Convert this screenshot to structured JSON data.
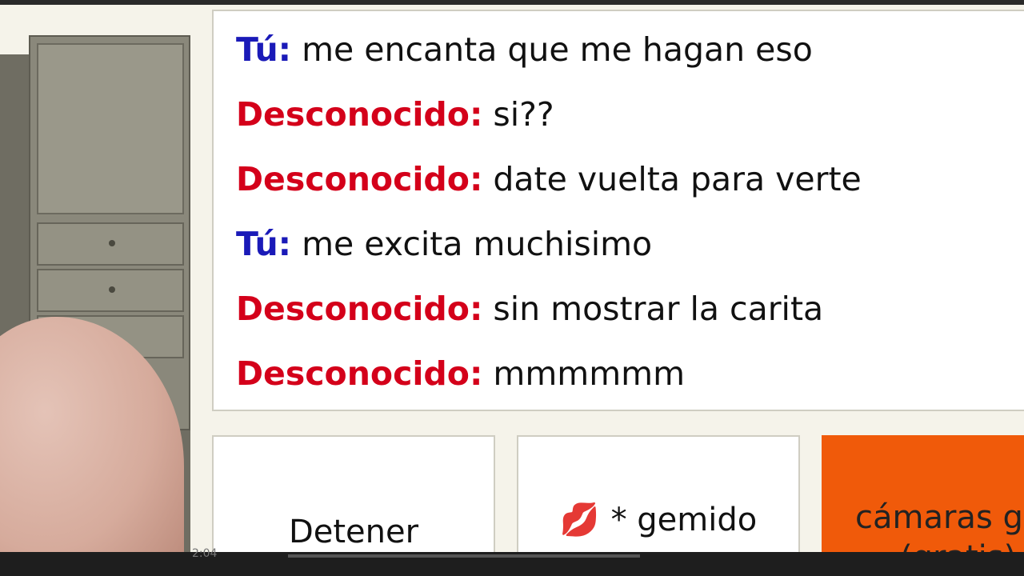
{
  "chat": {
    "messages": [
      {
        "speaker": "Tú:",
        "role": "you",
        "text": "me encanta que me hagan eso"
      },
      {
        "speaker": "Desconocido:",
        "role": "stranger",
        "text": "si??"
      },
      {
        "speaker": "Desconocido:",
        "role": "stranger",
        "text": "date vuelta para verte"
      },
      {
        "speaker": "Tú:",
        "role": "you",
        "text": "me excita muchisimo"
      },
      {
        "speaker": "Desconocido:",
        "role": "stranger",
        "text": "sin mostrar la carita"
      },
      {
        "speaker": "Desconocido:",
        "role": "stranger",
        "text": "mmmmmm"
      }
    ]
  },
  "buttons": {
    "stop_label": "Detener",
    "moan_icon": "lips-icon",
    "moan_label": "* gemido",
    "cams_line1": "cámaras g",
    "cams_line2": "(gratis)"
  },
  "player": {
    "time": "2:04"
  },
  "colors": {
    "you": "#1a1ab8",
    "stranger": "#d4001a",
    "cams_button": "#f05a0a"
  }
}
